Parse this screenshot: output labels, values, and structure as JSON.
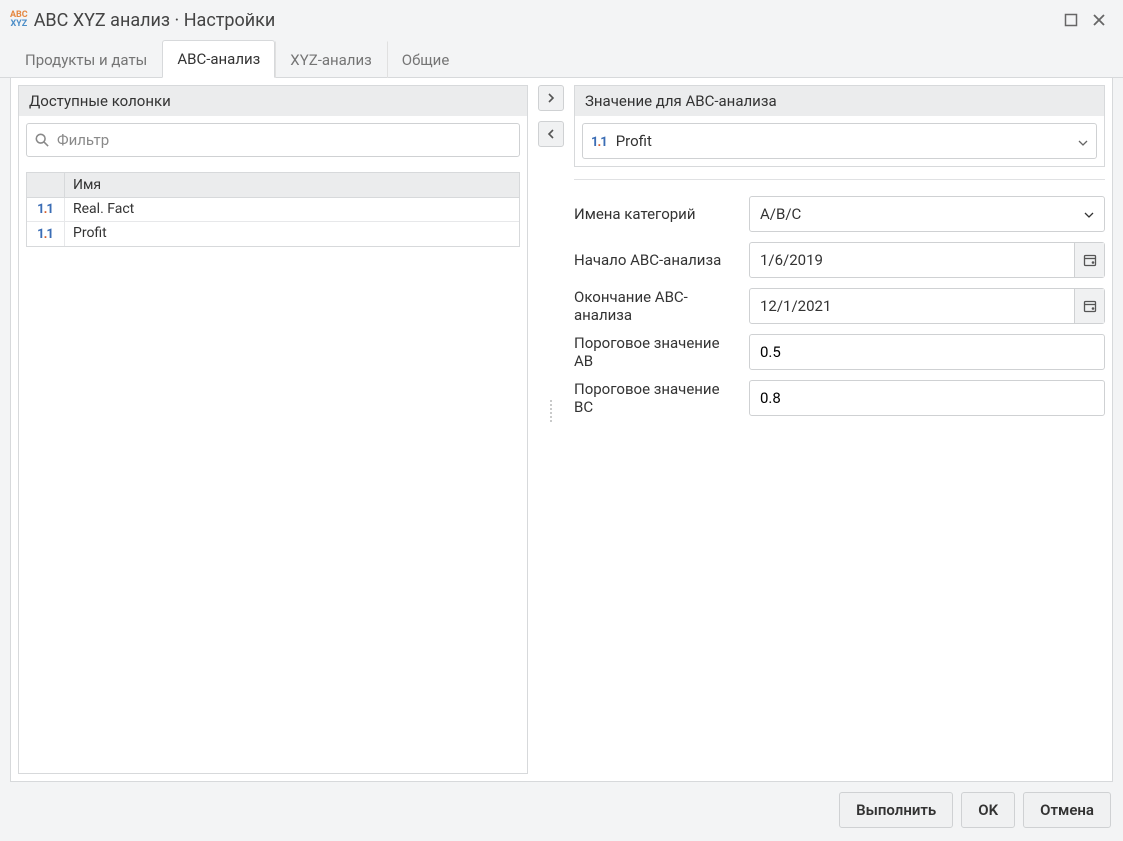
{
  "titlebar": {
    "logo": {
      "abc": "ABC",
      "xyz": "XYZ"
    },
    "title": "ABC XYZ анализ · Настройки"
  },
  "tabs": [
    {
      "label": "Продукты и даты",
      "active": false
    },
    {
      "label": "ABC-анализ",
      "active": true
    },
    {
      "label": "XYZ-анализ",
      "active": false
    },
    {
      "label": "Общие",
      "active": false
    }
  ],
  "left": {
    "header": "Доступные колонки",
    "filter_placeholder": "Фильтр",
    "column_header": "Имя",
    "rows": [
      {
        "icon": "numeric-icon",
        "name": "Real. Fact"
      },
      {
        "icon": "numeric-icon",
        "name": "Profit"
      }
    ]
  },
  "right": {
    "value_header": "Значение для ABC-анализа",
    "value_selected": "Profit",
    "categories_label": "Имена категорий",
    "categories_value": "A/B/C",
    "start_label": "Начало ABC-анализа",
    "start_value": "1/6/2019",
    "end_label": "Окончание ABC-анализа",
    "end_value": "12/1/2021",
    "threshold_ab_label": "Пороговое значение AB",
    "threshold_ab_value": "0.5",
    "threshold_bc_label": "Пороговое значение BC",
    "threshold_bc_value": "0.8"
  },
  "footer": {
    "run": "Выполнить",
    "ok": "OK",
    "cancel": "Отмена"
  }
}
